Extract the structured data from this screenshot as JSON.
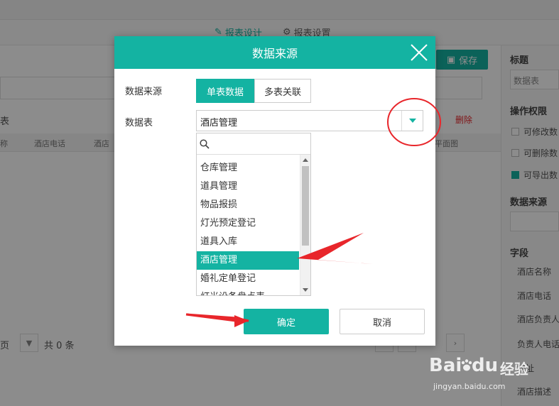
{
  "background": {
    "tabs": [
      {
        "label": "报表设计",
        "icon": "edit-icon",
        "active": true
      },
      {
        "label": "报表设置",
        "icon": "gear-icon",
        "active": false
      }
    ],
    "save_label": "保存",
    "grid_headers": [
      "称",
      "酒店电话",
      "酒店"
    ],
    "right_header_labels": [
      "删除",
      "平面图"
    ],
    "side_label": "表",
    "pager": {
      "page_suffix": "页",
      "total_text": "共 0 条"
    },
    "sidebar": {
      "title_label": "标题",
      "title_value": "数据表",
      "permissions_label": "操作权限",
      "permissions": [
        {
          "label": "可修改数",
          "checked": false
        },
        {
          "label": "可删除数",
          "checked": false
        },
        {
          "label": "可导出数",
          "checked": true
        }
      ],
      "datasource_label": "数据来源",
      "fields_label": "字段",
      "fields": [
        "酒店名称",
        "酒店电话",
        "酒店负责人",
        "负责人电话",
        "地址",
        "酒店描述"
      ]
    }
  },
  "dialog": {
    "title": "数据来源",
    "datasource_label": "数据来源",
    "segments": [
      {
        "label": "单表数据",
        "active": true
      },
      {
        "label": "多表关联",
        "active": false
      }
    ],
    "table_label": "数据表",
    "selected_table": "酒店管理",
    "search_placeholder": "",
    "options": [
      "仓库管理",
      "道具管理",
      "物品报损",
      "灯光预定登记",
      "道具入库",
      "酒店管理",
      "婚礼定单登记",
      "灯光设备盘点表"
    ],
    "selected_index": 5,
    "ok_label": "确定",
    "cancel_label": "取消"
  },
  "watermark": {
    "brand": "Bai",
    "brand2": "du",
    "cn": "经验",
    "url": "jingyan.baidu.com"
  },
  "colors": {
    "accent": "#14b3a2",
    "annotation": "#e8262b"
  }
}
